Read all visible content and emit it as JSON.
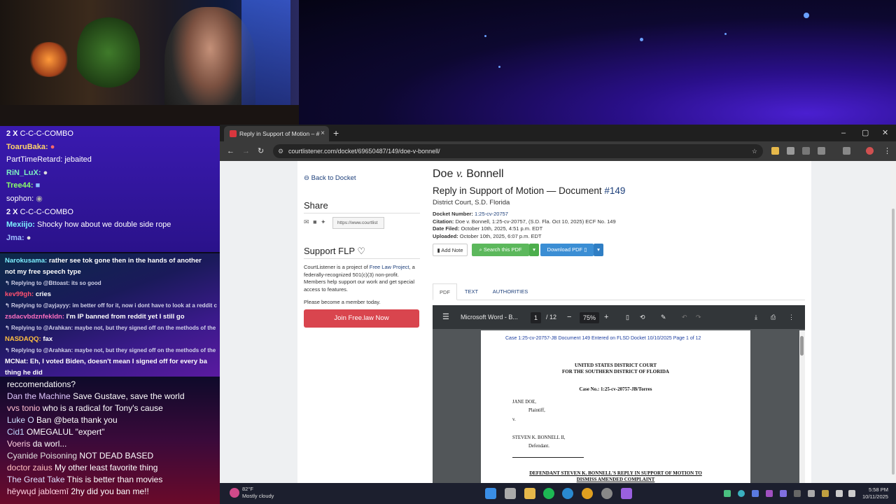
{
  "chat_top": [
    {
      "user": "2 X",
      "text": "C-C-C-COMBO",
      "user_color": "#ffffff"
    },
    {
      "user": "ToaruBaka:",
      "text": "",
      "user_color": "#ffd36a"
    },
    {
      "user": "PartTimeRetard:",
      "text": "jebaited",
      "user_color": "#ffffff"
    },
    {
      "user": "RiN_LuX:",
      "text": "",
      "user_color": "#7ef0c0"
    },
    {
      "user": "Tree44:",
      "text": "",
      "user_color": "#8aff6a"
    },
    {
      "user": "sophon:",
      "text": "",
      "user_color": "#ffffff"
    },
    {
      "user": "2 X",
      "text": "C-C-C-COMBO",
      "user_color": "#ffffff"
    },
    {
      "user": "Mexiijo:",
      "text": "Shocky how about we double side rope",
      "user_color": "#7ef0ff"
    },
    {
      "user": "Jma:",
      "text": "",
      "user_color": "#a0c0ff"
    }
  ],
  "chat_mid": [
    {
      "user": "Narokusama:",
      "text": "rather see tok gone then in the hands of another",
      "user_color": "#7ef0ff"
    },
    {
      "user": "",
      "text": "not my free speech type",
      "user_color": "#ffffff"
    },
    {
      "reply": "Replying to @Bttoast: its so good"
    },
    {
      "user": "kev99gh:",
      "text": "cries",
      "user_color": "#ff5070"
    },
    {
      "reply": "Replying to @ayjayyy: im better off for it, now i dont have to look at a reddit c"
    },
    {
      "user": "zsdacvbdznfekldn:",
      "text": "I'm IP banned from reddit yet I still go",
      "user_color": "#ff70c0"
    },
    {
      "reply": "Replying to @Arahkan: maybe not, but they signed off on the methods of the"
    },
    {
      "user": "NASDAQQ:",
      "text": "fax",
      "user_color": "#ffc040"
    },
    {
      "reply": "Replying to @Arahkan: maybe not, but they signed off on the methods of the"
    },
    {
      "user": "MCNat:",
      "text": "Eh, I voted Biden, doesn't mean I signed off for every ba",
      "user_color": "#ffffff"
    },
    {
      "user": "",
      "text": "thing he did",
      "user_color": "#ffffff"
    }
  ],
  "chat_bottom": [
    {
      "user": "",
      "text": "reccomendations?",
      "user_color": "#ffffff"
    },
    {
      "user": "Dan the Machine",
      "text": "Save Gustave, save the world",
      "user_color": "#e0c8ff"
    },
    {
      "user": "vvs tonio",
      "text": "who is a radical for Tony's cause",
      "user_color": "#ffc0d0"
    },
    {
      "user": "Luke O",
      "text": "Ban @beta thank you",
      "user_color": "#d0e0ff"
    },
    {
      "user": "Cid1",
      "text": "OMEGALUL \"expert\"",
      "user_color": "#c0d8ff"
    },
    {
      "user": "Voeris",
      "text": "da worl...",
      "user_color": "#ffd0e0"
    },
    {
      "user": "Cyanide Poisoning",
      "text": "NOT DEAD BASED",
      "user_color": "#e0e0e0"
    },
    {
      "user": "doctor zaius",
      "text": "My other least favorite thing",
      "user_color": "#ffc0c0"
    },
    {
      "user": "The Great Take",
      "text": "This is better than movies",
      "user_color": "#e0e0ff"
    },
    {
      "user": "hēywųd jablœmī",
      "text": "2hy did you ban me!!",
      "user_color": "#ffd0e0"
    }
  ],
  "browser": {
    "tab_title": "Reply in Support of Motion – #",
    "tab_close": "×",
    "new_tab": "+",
    "url": "courtlistener.com/docket/69650487/149/doe-v-bonnell/",
    "win_min": "–",
    "win_max": "▢",
    "win_close": "✕"
  },
  "sidebar": {
    "back": "Back to Docket",
    "share_heading": "Share",
    "share_url": "https://www.courtlist",
    "support_heading": "Support FLP",
    "support_pre": "CourtListener is a project of ",
    "support_link": "Free Law Project",
    "support_post": ", a federally-recognized 501(c)(3) non-profit. Members help support our work and get special access to features.",
    "member_text": "Please become a member today.",
    "join_button": "Join Free.law Now"
  },
  "document": {
    "case_left": "Doe",
    "case_v": "v.",
    "case_right": "Bonnell",
    "subtitle": "Reply in Support of Motion — Document ",
    "doc_number": "#149",
    "court": "District Court, S.D. Florida",
    "docket_label": "Docket Number:",
    "docket_value": "1:25-cv-20757",
    "citation_label": "Citation:",
    "citation_value": "Doe v. Bonnell, 1:25-cv-20757, (S.D. Fla. Oct 10, 2025) ECF No. 149",
    "filed_label": "Date Filed:",
    "filed_value": "October 10th, 2025, 4:51 p.m. EDT",
    "uploaded_label": "Uploaded:",
    "uploaded_value": "October 10th, 2025, 6:07 p.m. EDT",
    "add_note": "Add Note",
    "search_pdf": "Search this PDF",
    "download_pdf": "Download PDF",
    "tabs": [
      "PDF",
      "TEXT",
      "AUTHORITIES"
    ]
  },
  "pdf_viewer": {
    "filename": "Microsoft Word - B...",
    "page": "1",
    "page_total": "/ 12",
    "zoom": "75%",
    "header": "Case 1:25-cv-20757-JB    Document 149    Entered on FLSD Docket 10/10/2025    Page 1 of 12",
    "court_line1": "UNITED STATES DISTRICT COURT",
    "court_line2": "FOR THE SOUTHERN DISTRICT OF FLORIDA",
    "case_no": "Case No.: 1:25-cv-20757-JB/Torres",
    "plaintiff": "JANE DOE,",
    "plaintiff_role": "Plaintiff,",
    "v": "v.",
    "defendant": "STEVEN K. BONNELL II,",
    "defendant_role": "Defendant.",
    "title_line1": "DEFENDANT STEVEN K. BONNELL'S REPLY IN SUPPORT OF MOTION TO",
    "title_line2": "DISMISS AMENDED COMPLAINT"
  },
  "taskbar": {
    "temp": "82°F",
    "weather": "Mostly cloudy",
    "time": "5:58 PM",
    "date": "10/11/2025"
  }
}
